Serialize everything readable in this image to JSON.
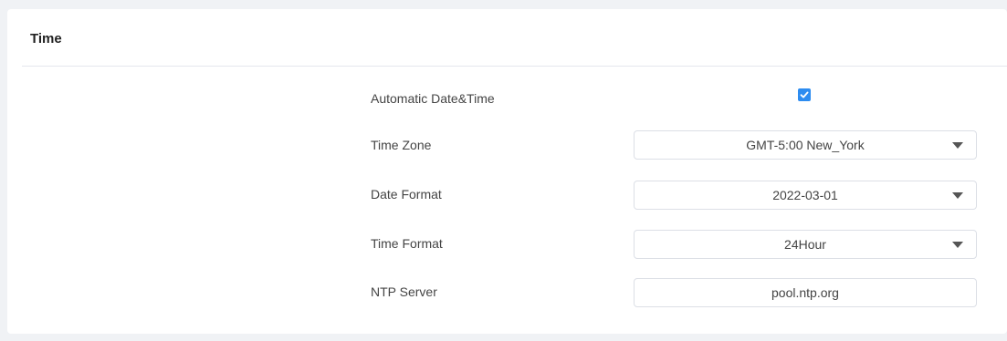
{
  "section": {
    "title": "Time"
  },
  "colors": {
    "accent": "#2d8cf0",
    "background": "#f0f2f5",
    "panel": "#ffffff",
    "border": "#dcdfe6"
  },
  "rows": {
    "automatic": {
      "label": "Automatic Date&Time",
      "checked": true,
      "icon": "checkmark-icon"
    },
    "time_zone": {
      "label": "Time Zone",
      "value": "GMT-5:00 New_York",
      "icon": "chevron-down-icon"
    },
    "date_format": {
      "label": "Date Format",
      "value": "2022-03-01",
      "icon": "chevron-down-icon"
    },
    "time_format": {
      "label": "Time Format",
      "value": "24Hour",
      "icon": "chevron-down-icon"
    },
    "ntp_server": {
      "label": "NTP Server",
      "value": "pool.ntp.org"
    }
  }
}
